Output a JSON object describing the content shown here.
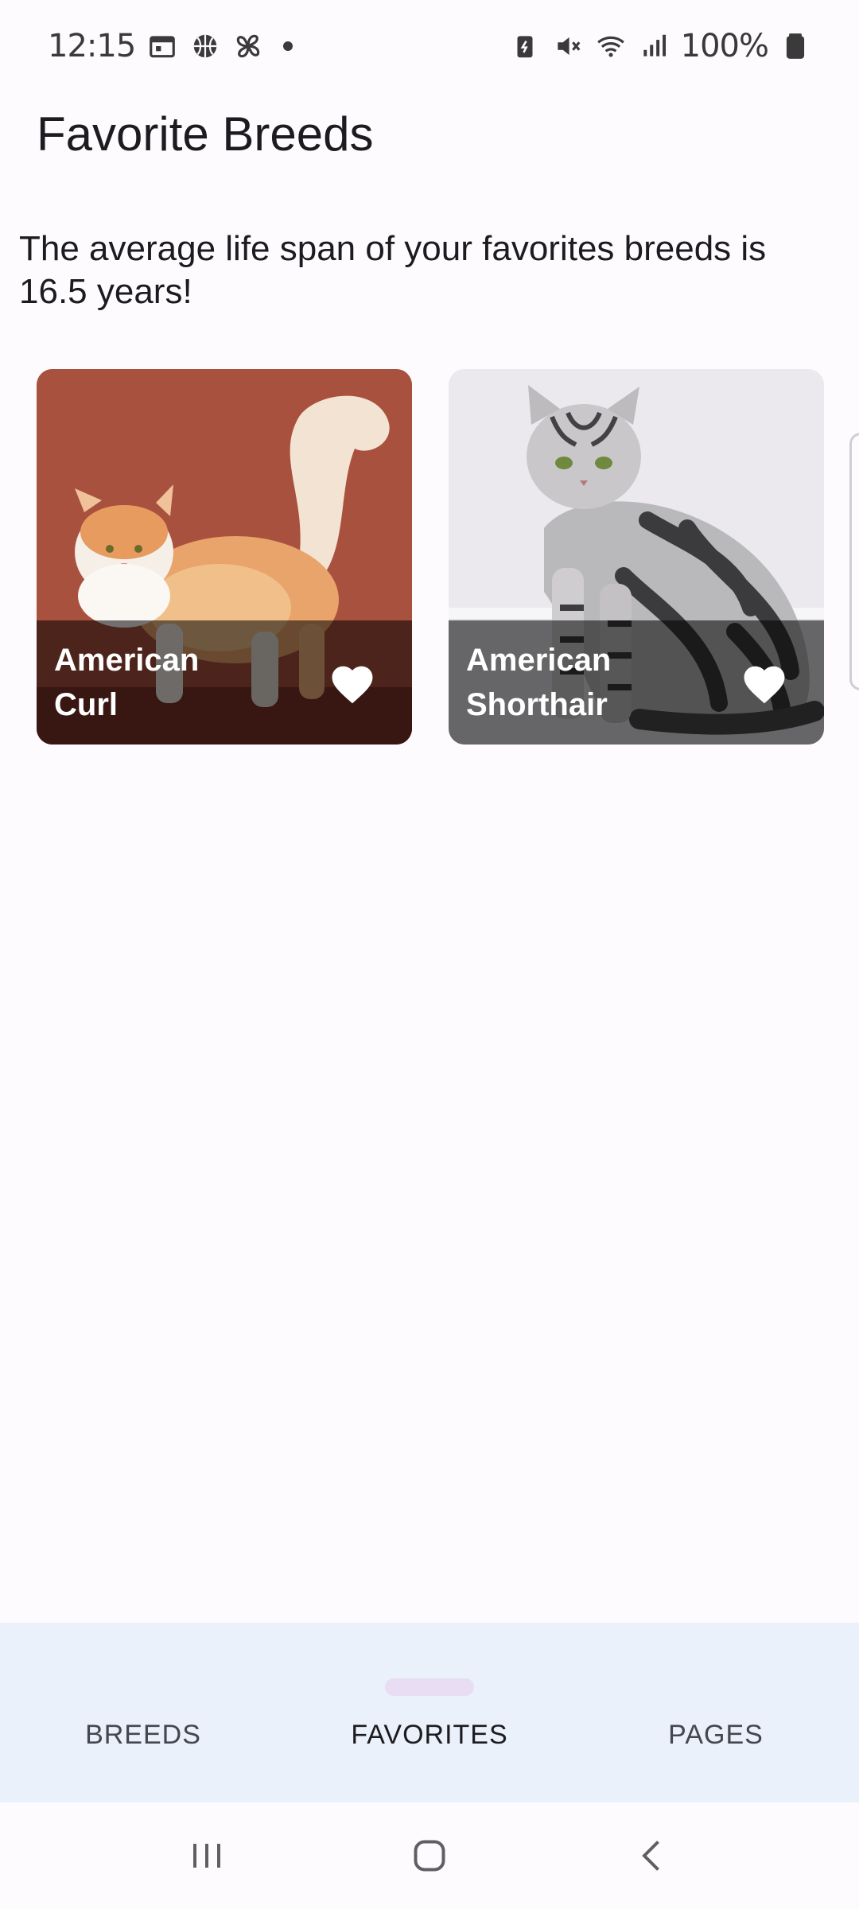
{
  "status_bar": {
    "time": "12:15",
    "left_icons": [
      "calendar-icon",
      "basketball-icon",
      "pinwheel-icon",
      "notification-dot"
    ],
    "right_icons": [
      "battery-saver-icon",
      "mute-icon",
      "wifi-icon",
      "signal-icon"
    ],
    "battery": "100%"
  },
  "header": {
    "title": "Favorite Breeds"
  },
  "summary": {
    "life_span_text": "The average life span of your favorites breeds is 16.5 years!"
  },
  "favorites": [
    {
      "name": "American Curl",
      "favorite": true
    },
    {
      "name": "American Shorthair",
      "favorite": true
    }
  ],
  "bottom_nav": {
    "items": [
      {
        "label": "BREEDS",
        "active": false
      },
      {
        "label": "FAVORITES",
        "active": true
      },
      {
        "label": "PAGES",
        "active": false
      }
    ]
  },
  "system_nav": [
    "recents-icon",
    "home-icon",
    "back-icon"
  ],
  "colors": {
    "background": "#fefbff",
    "nav_background": "#eaf1fb",
    "nav_indicator": "#e8ddf3",
    "card_overlay": "rgba(0,0,0,0.55)"
  }
}
